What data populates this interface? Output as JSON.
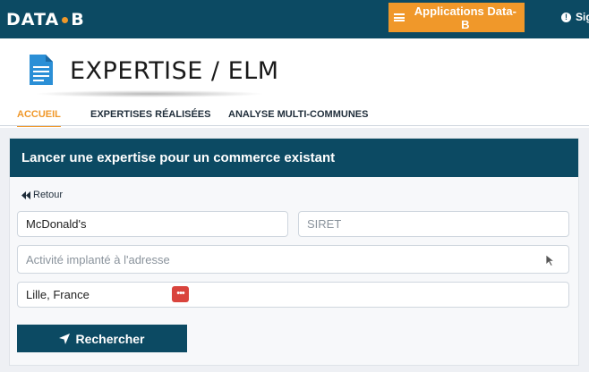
{
  "brand": {
    "logo_left": "DATA",
    "logo_right": "B"
  },
  "topbar": {
    "apps_label": "Applications Data-B",
    "signin_label": "Sig"
  },
  "page": {
    "title": "EXPERTISE / ELM"
  },
  "tabs": [
    {
      "label": "ACCUEIL",
      "active": true
    },
    {
      "label": "EXPERTISES RÉALISÉES",
      "active": false
    },
    {
      "label": "ANALYSE MULTI-COMMUNES",
      "active": false
    }
  ],
  "card": {
    "header": "Lancer une expertise pour un commerce existant",
    "back_label": "Retour",
    "fields": {
      "name_value": "McDonald's",
      "siret_placeholder": "SIRET",
      "activity_placeholder": "Activité implanté à l'adresse",
      "location_value": "Lille, France"
    },
    "search_label": "Rechercher"
  },
  "colors": {
    "primary": "#0c4a63",
    "accent": "#f0982a",
    "danger": "#d9443d"
  }
}
